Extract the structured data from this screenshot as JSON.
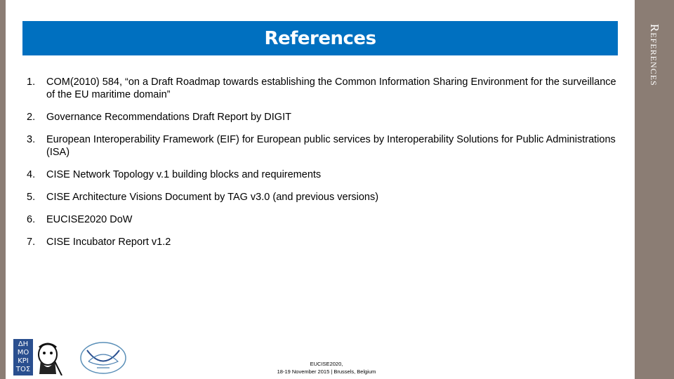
{
  "slide": {
    "title": "References",
    "side_title": "References"
  },
  "references": [
    {
      "num": "1.",
      "text": "COM(2010) 584, “on a Draft Roadmap towards establishing the Common Information Sharing Environment for the surveillance of the EU maritime domain”"
    },
    {
      "num": "2.",
      "text": "Governance Recommendations Draft Report by DIGIT"
    },
    {
      "num": "3.",
      "text": "European Interoperability Framework (EIF) for European public services by Interoperability Solutions for Public Administrations (ISA)"
    },
    {
      "num": "4.",
      "text": "CISE Network Topology v.1 building blocks and requirements"
    },
    {
      "num": "5.",
      "text": "CISE Architecture Visions Document by TAG v3.0 (and previous versions)"
    },
    {
      "num": "6.",
      "text": "EUCISE2020 DoW"
    },
    {
      "num": "7.",
      "text": "CISE Incubator Report v1.2"
    }
  ],
  "logos": {
    "demokritos_text": "ΔΗ ΜΟ ΚΡΙ ΤΟΣ"
  },
  "footer": {
    "line1": "EUCISE2020,",
    "line2": "18-19 November 2015 | Brussels, Belgium"
  },
  "colors": {
    "title_band": "#0070c0",
    "side_bars": "#8b7d74"
  }
}
